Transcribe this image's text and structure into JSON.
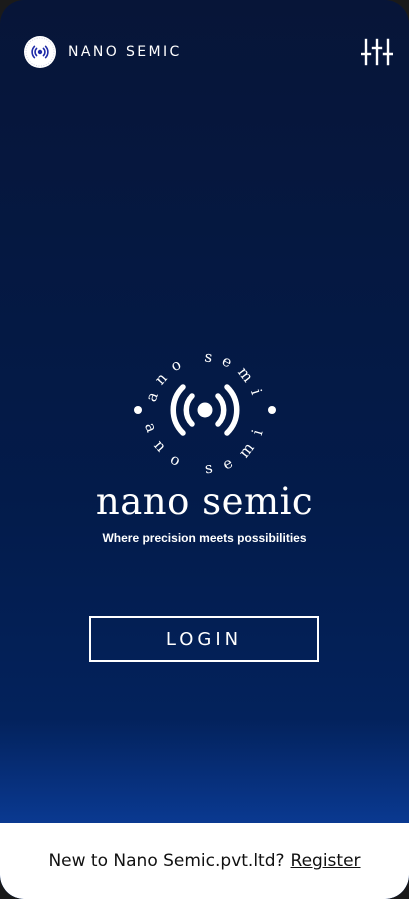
{
  "app": {
    "brand_name": "NANO SEMIC"
  },
  "header": {
    "menu_icon": "sliders-icon"
  },
  "hero": {
    "arc_text_top": "nano semic",
    "arc_text_bottom": "nano semic",
    "wordmark": "nano semic",
    "tagline": "Where precision meets possibilities"
  },
  "login": {
    "label": "LOGIN"
  },
  "footer": {
    "prompt": "New to Nano Semic.pvt.ltd?",
    "register_label": "Register"
  },
  "colors": {
    "background_top": "#071538",
    "background_bottom": "#0b3fa3",
    "accent_logo": "#1f2aa8",
    "text": "#ffffff"
  }
}
